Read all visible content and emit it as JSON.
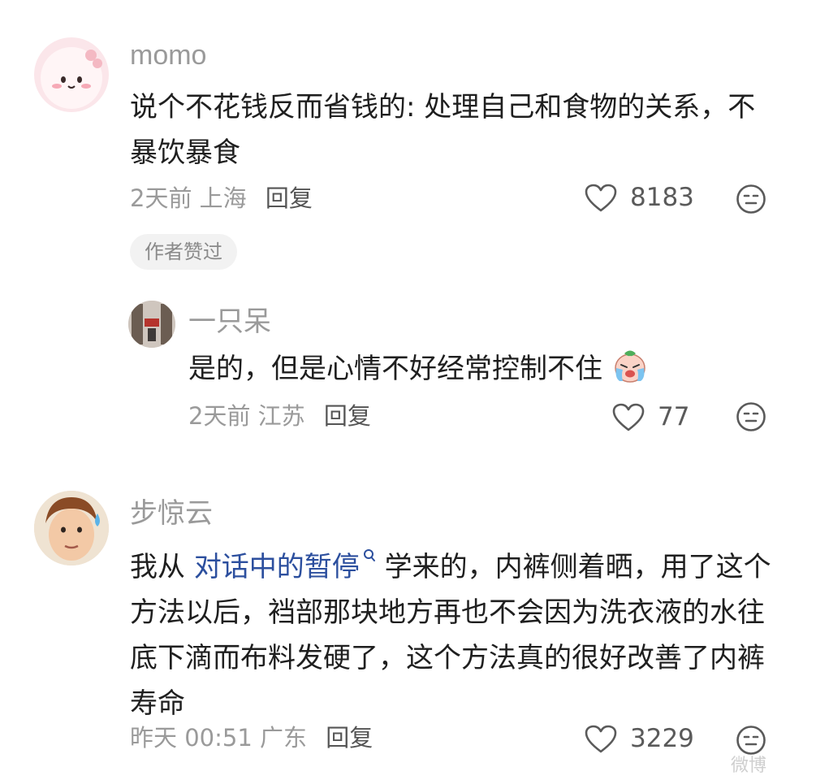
{
  "comments": [
    {
      "author": "momo",
      "text": "说个不花钱反而省钱的: 处理自己和食物的关系，不暴饮暴食",
      "time": "2天前",
      "location": "上海",
      "reply_label": "回复",
      "likes": "8183",
      "badge": "作者赞过",
      "replies": [
        {
          "author": "一只呆",
          "text": "是的，但是心情不好经常控制不住",
          "time": "2天前",
          "location": "江苏",
          "reply_label": "回复",
          "likes": "77"
        }
      ]
    },
    {
      "author": "步惊云",
      "text_before": "我从 ",
      "link_text": "对话中的暂停",
      "text_after": " 学来的，内裤侧着晒，用了这个方法以后，裆部那块地方再也不会因为洗衣液的水往底下滴而布料发硬了，这个方法真的很好改善了内裤寿命",
      "time": "昨天 00:51",
      "location": "广东",
      "reply_label": "回复",
      "likes": "3229"
    }
  ],
  "watermark": "微博",
  "icons": {
    "like": "heart-outline-icon",
    "dislike": "neutral-face-icon",
    "search": "search-icon",
    "emoji": "crying-emoji-icon"
  },
  "colors": {
    "text": "#1f1f1f",
    "muted": "#9a9a9a",
    "link": "#2c4f9e",
    "badge_bg": "#f2f2f2"
  }
}
